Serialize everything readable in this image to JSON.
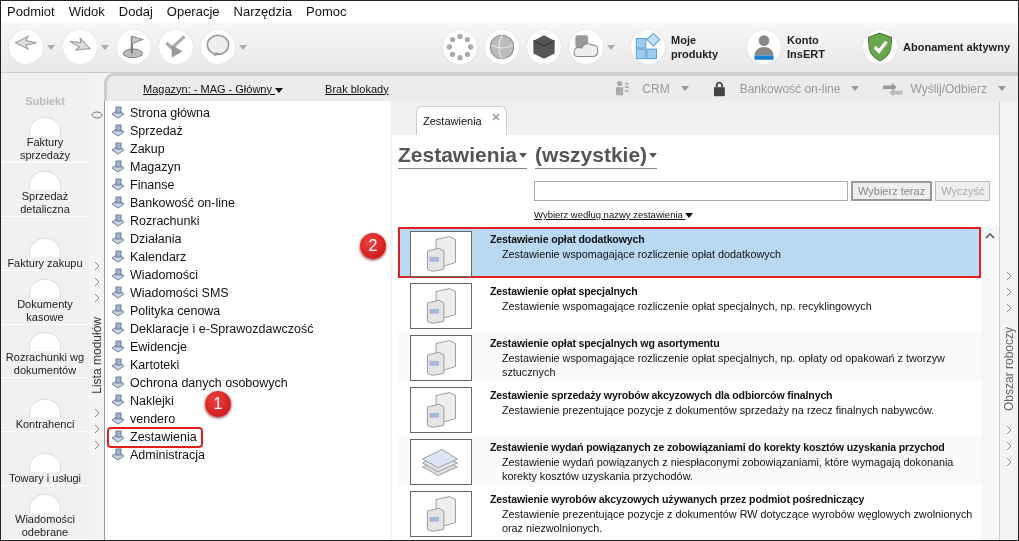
{
  "menu": [
    "Podmiot",
    "Widok",
    "Dodaj",
    "Operacje",
    "Narzędzia",
    "Pomoc"
  ],
  "toolbar": {
    "left": [
      {
        "kind": "back"
      },
      {
        "kind": "forward"
      },
      {
        "kind": "flag"
      },
      {
        "kind": "checks"
      },
      {
        "kind": "help"
      }
    ],
    "right": [
      {
        "kind": "spinner"
      },
      {
        "kind": "globe"
      },
      {
        "kind": "cube"
      },
      {
        "kind": "cloud"
      }
    ],
    "labelled": [
      {
        "kind": "products",
        "label": "Moje produkty"
      },
      {
        "kind": "account",
        "label": "Konto InsERT"
      },
      {
        "kind": "shield",
        "label": "Abonament aktywny"
      }
    ]
  },
  "app_logo": "Subiekt",
  "nav": [
    {
      "label": "Faktury sprzedaży"
    },
    {
      "label": "Sprzedaż detaliczna"
    },
    {
      "label": "Faktury zakupu"
    },
    {
      "label": "Dokumenty kasowe"
    },
    {
      "label": "Rozrachunki wg dokumentów"
    },
    {
      "label": "Kontrahenci"
    },
    {
      "label": "Towary i usługi"
    },
    {
      "label": "Wiadomości odebrane"
    }
  ],
  "topbar": {
    "warehouse": "Magazyn: - MAG - Główny",
    "lock": "Brak blokady",
    "tools": [
      {
        "label": "CRM",
        "kind": "crm"
      },
      {
        "label": "Bankowość on-line",
        "kind": "bank"
      },
      {
        "label": "Wyślij/Odbierz",
        "kind": "sync"
      }
    ]
  },
  "modules": {
    "title": "Lista modułów",
    "items": [
      {
        "label": "Strona główna",
        "outlined": false
      },
      {
        "label": "Sprzedaż",
        "outlined": false
      },
      {
        "label": "Zakup",
        "outlined": false
      },
      {
        "label": "Magazyn",
        "outlined": false
      },
      {
        "label": "Finanse",
        "outlined": false
      },
      {
        "label": "Bankowość on-line",
        "outlined": false
      },
      {
        "label": "Rozrachunki",
        "outlined": false
      },
      {
        "label": "Działania",
        "outlined": false
      },
      {
        "label": "Kalendarz",
        "outlined": false
      },
      {
        "label": "Wiadomości",
        "outlined": false
      },
      {
        "label": "Wiadomości SMS",
        "outlined": false
      },
      {
        "label": "Polityka cenowa",
        "outlined": false
      },
      {
        "label": "Deklaracje i e-Sprawozdawczość",
        "outlined": false
      },
      {
        "label": "Ewidencje",
        "outlined": false
      },
      {
        "label": "Kartoteki",
        "outlined": false
      },
      {
        "label": "Ochrona danych osobowych",
        "outlined": false
      },
      {
        "label": "Naklejki",
        "outlined": false
      },
      {
        "label": "vendero",
        "outlined": false
      },
      {
        "label": "Zestawienia",
        "outlined": true
      },
      {
        "label": "Administracja",
        "outlined": false
      }
    ]
  },
  "workspace": {
    "tab": "Zestawienia",
    "category": "Zestawienia",
    "filter": "(wszystkie)",
    "buttons": [
      {
        "label": "Wybierz teraz",
        "disabled": false
      },
      {
        "label": "Wyczyść",
        "disabled": true
      }
    ],
    "sort_link": "Wybierz według nazwy zestawienia",
    "reports": [
      {
        "title": "Zestawienie opłat dodatkowych",
        "description": "Zestawienie wspomagające rozliczenie opłat dodatkowych",
        "kind": "boxes",
        "selected": true
      },
      {
        "title": "Zestawienie opłat specjalnych",
        "description": "Zestawienie wspomagające rozliczenie opłat specjalnych, np. recyklingowych",
        "kind": "boxes",
        "selected": false
      },
      {
        "title": "Zestawienie opłat specjalnych wg asortymentu",
        "description": "Zestawienie wspomagające rozliczenie opłat specjalnych, np. opłaty od opakowań z tworzyw sztucznych",
        "kind": "boxes",
        "selected": false
      },
      {
        "title": "Zestawienie sprzedaży wyrobów akcyzowych dla odbiorców finalnych",
        "description": "Zestawienie prezentujące pozycje z dokumentów sprzedaży na rzecz finalnych nabywców.",
        "kind": "boxes",
        "selected": false
      },
      {
        "title": "Zestawienie wydań powiązanych ze zobowiązaniami do korekty kosztów uzyskania przychod",
        "description": "Zestawienie wydań powiązanych z niespłaconymi zobowiązaniami, które wymagają dokonania korekty kosztów uzyskania przychodów.",
        "kind": "sheets",
        "selected": false
      },
      {
        "title": "Zestawienie wyrobów akcyzowych używanych przez podmiot pośredniczący",
        "description": "Zestawienie prezentujące pozycje z dokumentów RW dotyczące wyrobów węglowych zwolnionych oraz niezwolnionych.",
        "kind": "boxes",
        "selected": false
      }
    ]
  },
  "side_panel": "Obszar roboczy",
  "callouts": [
    "1",
    "2"
  ]
}
